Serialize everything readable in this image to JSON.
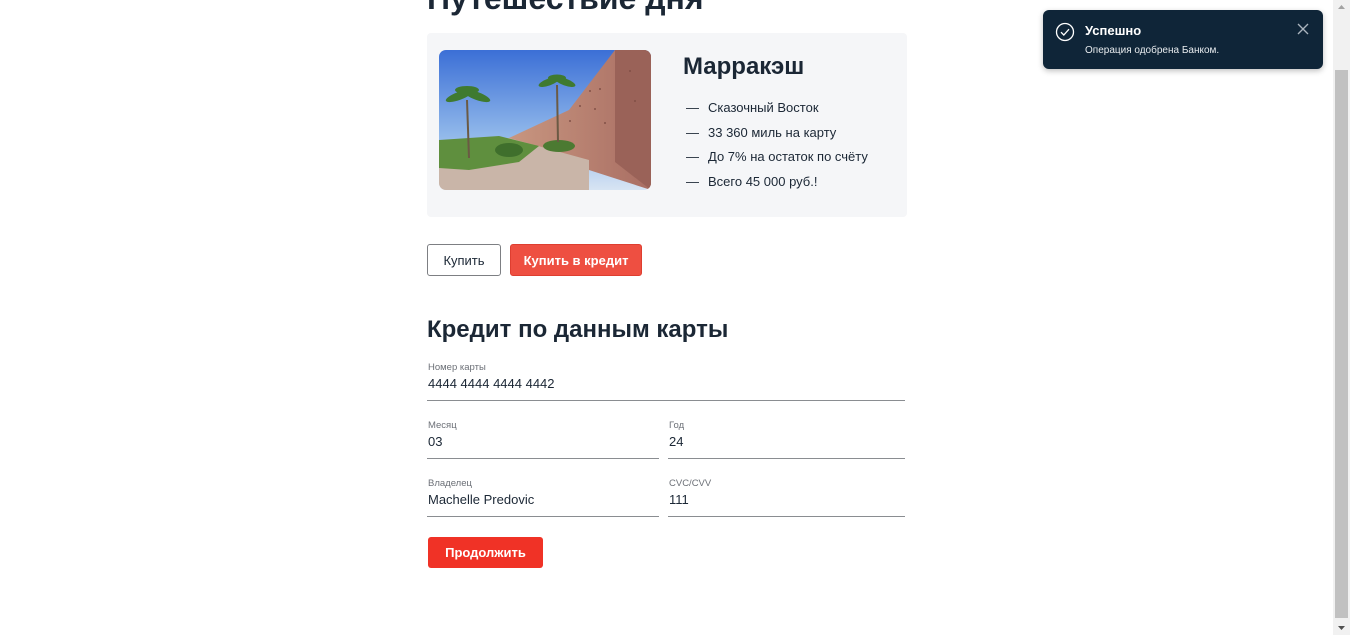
{
  "page": {
    "title": "Путешествие дня"
  },
  "offer": {
    "city": "Марракэш",
    "image_alt": "Marrakesh city walls with palm trees",
    "features": [
      "Сказочный Восток",
      "33 360 миль на карту",
      "До 7% на остаток по счёту",
      "Всего 45 000 руб.!"
    ],
    "dash": "—"
  },
  "actions": {
    "buy_label": "Купить",
    "buy_credit_label": "Купить в кредит"
  },
  "form": {
    "title": "Кредит по данным карты",
    "card_number": {
      "label": "Номер карты",
      "value": "4444 4444 4444 4442"
    },
    "month": {
      "label": "Месяц",
      "value": "03"
    },
    "year": {
      "label": "Год",
      "value": "24"
    },
    "owner": {
      "label": "Владелец",
      "value": "Machelle Predovic"
    },
    "cvc": {
      "label": "CVC/CVV",
      "value": "111"
    },
    "continue_label": "Продолжить"
  },
  "notification": {
    "title": "Успешно",
    "message": "Операция одобрена Банком.",
    "icon": "check-circle-icon",
    "close_icon": "close-icon"
  },
  "colors": {
    "text": "#1b2735",
    "accent_red": "#ee4f41",
    "continue_red": "#f03226",
    "toast_bg": "#0f2538",
    "card_bg": "#f5f6f8"
  }
}
